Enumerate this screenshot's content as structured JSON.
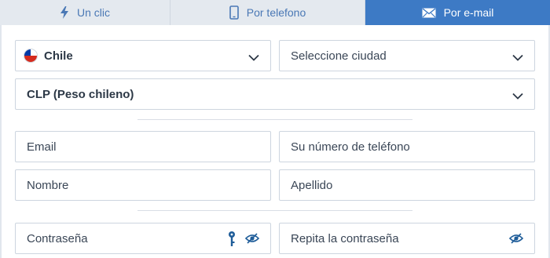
{
  "tabs": [
    {
      "label": "Un clic",
      "icon": "lightning-icon",
      "active": false
    },
    {
      "label": "Por telefono",
      "icon": "phone-icon",
      "active": false
    },
    {
      "label": "Por e-mail",
      "icon": "envelope-icon",
      "active": true
    }
  ],
  "form": {
    "country": {
      "value": "Chile",
      "flag": "chile-flag-icon"
    },
    "city": {
      "placeholder": "Seleccione ciudad"
    },
    "currency": {
      "value": "CLP (Peso chileno)"
    },
    "email": {
      "placeholder": "Email"
    },
    "phone": {
      "placeholder": "Su número de teléfono"
    },
    "first_name": {
      "placeholder": "Nombre"
    },
    "last_name": {
      "placeholder": "Apellido"
    },
    "password": {
      "placeholder": "Contraseña"
    },
    "password_repeat": {
      "placeholder": "Repita la contraseña"
    }
  },
  "colors": {
    "active_tab_bg": "#3d7ac5",
    "inactive_tab_bg": "#e4e9ef",
    "accent": "#4a78b5",
    "icon_dark": "#1f5d99"
  }
}
